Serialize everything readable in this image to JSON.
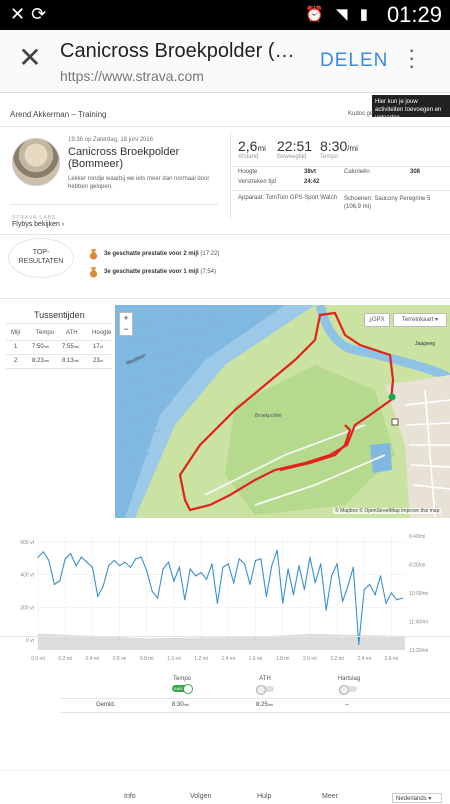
{
  "status_bar": {
    "time": "01:29",
    "icons": [
      "missed-call-icon",
      "sync-icon",
      "alarm-icon",
      "wifi-icon",
      "signal-icon",
      "battery-icon"
    ]
  },
  "browser": {
    "title": "Canicross Broekpolder (…",
    "url": "https://www.strava.com",
    "share_label": "DELEN"
  },
  "tooltip": {
    "text": "Hier kun je jouw activiteiten toevoegen en uploaden."
  },
  "activity": {
    "breadcrumb": "Arend Akkerman – Training",
    "kudos": "Kudos ge",
    "date": "19:36 op Zaterdag, 18 juni 2016",
    "title": "Canicross Broekpolder (Bommeer)",
    "description": "Lekker rondje waarbij we iets meer dan normaal door hebben gelopen.",
    "stats": [
      {
        "value": "2,6",
        "unit": "mi",
        "label": "Afstand"
      },
      {
        "value": "22:51",
        "unit": "",
        "label": "Beweegtijd"
      },
      {
        "value": "8:30",
        "unit": "/mi",
        "label": "Tempo"
      }
    ],
    "details": {
      "hoogte_label": "Hoogte",
      "hoogte_value": "38vt",
      "calorieen_label": "Calorieën",
      "calorieen_value": "308",
      "verstreken_label": "Verstreken tijd",
      "verstreken_value": "24:42",
      "apparaat": "Apparaat: TomTom GPS Sport Watch",
      "schoenen": "Schoenen: Saucony Peregrine 5 (106,9 mi)"
    },
    "flyby_header": "STRAVA LABS",
    "flyby_link": "Flybys bekijken",
    "top_results_label_1": "TOP-",
    "top_results_label_2": "RESULTATEN",
    "achievements": [
      {
        "text": "3e geschatte prestatie voor 2 mijl",
        "time": "(17:22)"
      },
      {
        "text": "3e geschatte prestatie voor 1 mijl",
        "time": "(7:54)"
      }
    ]
  },
  "splits": {
    "title": "Tussentijden",
    "headers": [
      "Mijl",
      "Tempo",
      "ATH",
      "Hoogte"
    ],
    "rows": [
      [
        "1",
        "7:50",
        "/mi",
        "7:55",
        "/mi",
        "17",
        "vt"
      ],
      [
        "2",
        "8:23",
        "/mi",
        "8:13",
        "/mi",
        "23",
        "vt"
      ]
    ]
  },
  "map": {
    "zoom_in": "+",
    "zoom_out": "−",
    "gpx_label": "GPX",
    "terrain_label": "Terreinkaart",
    "attribution": "© Mapbox © OpenStreetMap Improve this map",
    "labels": [
      "Westlaan",
      "Broekpolder",
      "Jaagweg"
    ]
  },
  "chart_data": {
    "type": "line",
    "x_ticks": [
      "0.0 mi",
      "0.2 mi",
      "0.4 mi",
      "0.6 mi",
      "0.8 mi",
      "1.0 mi",
      "1.2 mi",
      "1.4 mi",
      "1.6 mi",
      "1.8 mi",
      "2.0 mi",
      "2.2 mi",
      "2.4 mi",
      "2.6 mi"
    ],
    "y_left_ticks": [
      "600 vt",
      "400 vt",
      "200 vt",
      "0 vt"
    ],
    "y_right_ticks": [
      "6:40/mi",
      "8:20/mi",
      "10:00/mi",
      "11:40/mi",
      "13:20/mi"
    ],
    "xlim": [
      0,
      2.7
    ],
    "series": [
      {
        "name": "Tempo",
        "color": "#3a8fd0",
        "x": [
          0.0,
          0.04,
          0.08,
          0.12,
          0.16,
          0.2,
          0.24,
          0.28,
          0.32,
          0.36,
          0.4,
          0.44,
          0.48,
          0.52,
          0.56,
          0.6,
          0.64,
          0.68,
          0.72,
          0.76,
          0.8,
          0.84,
          0.88,
          0.92,
          0.96,
          1.0,
          1.04,
          1.08,
          1.12,
          1.16,
          1.2,
          1.24,
          1.28,
          1.32,
          1.36,
          1.4,
          1.44,
          1.48,
          1.52,
          1.56,
          1.6,
          1.64,
          1.68,
          1.72,
          1.76,
          1.8,
          1.84,
          1.88,
          1.92,
          1.96,
          2.0,
          2.04,
          2.08,
          2.12,
          2.16,
          2.2,
          2.24,
          2.28,
          2.32,
          2.36,
          2.4,
          2.44,
          2.48,
          2.52,
          2.56,
          2.6,
          2.64,
          2.68
        ],
        "y": [
          7.9,
          7.6,
          8.1,
          9.5,
          9.3,
          8.0,
          7.7,
          8.4,
          7.9,
          8.2,
          8.5,
          10.2,
          9.6,
          8.4,
          8.1,
          8.4,
          8.2,
          8.5,
          8.0,
          7.9,
          8.7,
          9.9,
          10.3,
          8.6,
          8.2,
          9.3,
          8.5,
          10.4,
          8.6,
          9.0,
          8.8,
          9.2,
          8.3,
          10.6,
          8.5,
          8.3,
          9.4,
          8.0,
          8.3,
          9.5,
          8.1,
          8.0,
          10.2,
          8.4,
          7.5,
          10.6,
          8.6,
          10.1,
          8.4,
          9.8,
          7.9,
          9.4,
          8.3,
          11.0,
          9.0,
          8.3,
          10.5,
          9.6,
          8.5,
          13.0,
          9.8,
          9.5,
          10.1,
          9.0,
          10.6,
          10.0,
          10.4,
          10.3
        ]
      },
      {
        "name": "Hoogte",
        "color": "#cfcfcf",
        "x": [
          0.0,
          0.4,
          0.8,
          1.2,
          1.6,
          2.0,
          2.4,
          2.7
        ],
        "y": [
          40,
          25,
          10,
          15,
          20,
          38,
          30,
          25
        ]
      }
    ]
  },
  "chart_controls": {
    "tempo_label": "Tempo",
    "tempo_toggle_text": "AAN",
    "ath_label": "ATH",
    "hartslag_label": "Hartslag",
    "gemid_label": "Gemid.",
    "tempo_avg": "8:30",
    "tempo_avg_unit": "/mi",
    "ath_avg": "8:25",
    "ath_avg_unit": "/mi",
    "hartslag_avg": "--"
  },
  "footer": {
    "links": [
      "Info",
      "Volgen",
      "Hulp",
      "Meer"
    ],
    "language": "Nederlands"
  }
}
